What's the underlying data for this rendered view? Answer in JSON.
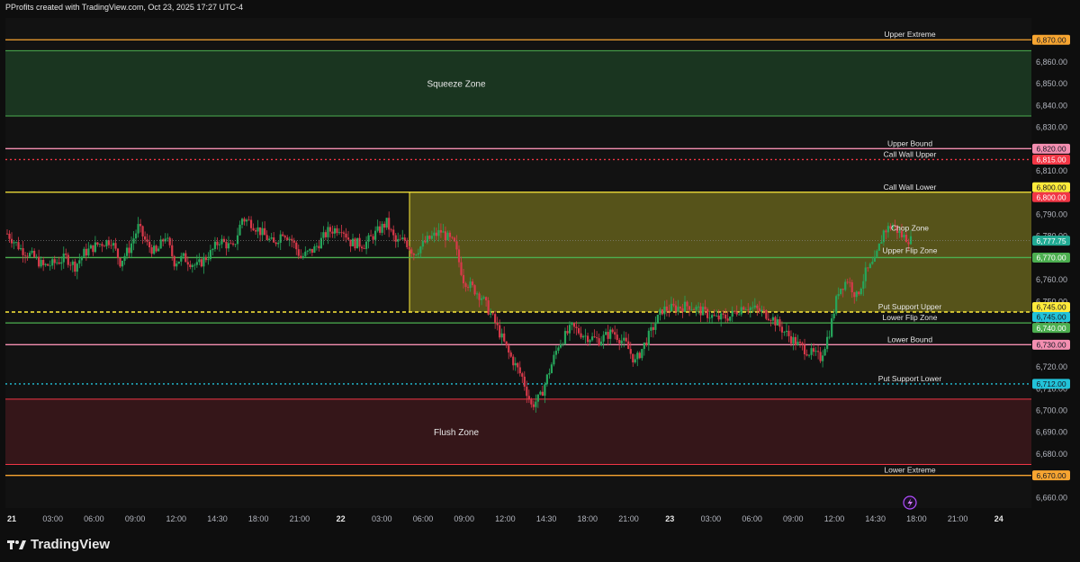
{
  "header": {
    "attribution": "PProfits created with TradingView.com, Oct 23, 2025 17:27 UTC-4"
  },
  "footer": {
    "brand": "TradingView"
  },
  "chart_data": {
    "type": "candlestick",
    "symbol_interval": "intraday",
    "ylim": [
      6655,
      6880
    ],
    "y_ticks": [
      6660,
      6670,
      6680,
      6690,
      6700,
      6710,
      6720,
      6730,
      6740,
      6750,
      6760,
      6770,
      6780,
      6790,
      6800,
      6810,
      6820,
      6830,
      6840,
      6850,
      6860,
      6870
    ],
    "x_ticks": [
      {
        "label": "21",
        "bold": true
      },
      {
        "label": "03:00"
      },
      {
        "label": "06:00"
      },
      {
        "label": "09:00"
      },
      {
        "label": "12:00"
      },
      {
        "label": "14:30"
      },
      {
        "label": "18:00"
      },
      {
        "label": "21:00"
      },
      {
        "label": "22",
        "bold": true
      },
      {
        "label": "03:00"
      },
      {
        "label": "06:00"
      },
      {
        "label": "09:00"
      },
      {
        "label": "12:00"
      },
      {
        "label": "14:30"
      },
      {
        "label": "18:00"
      },
      {
        "label": "21:00"
      },
      {
        "label": "23",
        "bold": true
      },
      {
        "label": "03:00"
      },
      {
        "label": "06:00"
      },
      {
        "label": "09:00"
      },
      {
        "label": "12:00"
      },
      {
        "label": "14:30"
      },
      {
        "label": "18:00"
      },
      {
        "label": "21:00"
      },
      {
        "label": "24",
        "bold": true
      }
    ],
    "price_path": [
      [
        0,
        6781
      ],
      [
        6,
        6774
      ],
      [
        12,
        6770
      ],
      [
        16,
        6766
      ],
      [
        20,
        6767
      ],
      [
        26,
        6770
      ],
      [
        30,
        6766
      ],
      [
        34,
        6772
      ],
      [
        40,
        6776
      ],
      [
        46,
        6778
      ],
      [
        50,
        6768
      ],
      [
        54,
        6774
      ],
      [
        58,
        6784
      ],
      [
        62,
        6776
      ],
      [
        66,
        6772
      ],
      [
        70,
        6780
      ],
      [
        74,
        6768
      ],
      [
        78,
        6770
      ],
      [
        84,
        6766
      ],
      [
        90,
        6772
      ],
      [
        94,
        6778
      ],
      [
        100,
        6774
      ],
      [
        104,
        6788
      ],
      [
        108,
        6786
      ],
      [
        112,
        6782
      ],
      [
        118,
        6776
      ],
      [
        122,
        6782
      ],
      [
        126,
        6778
      ],
      [
        130,
        6770
      ],
      [
        136,
        6774
      ],
      [
        142,
        6782
      ],
      [
        148,
        6784
      ],
      [
        152,
        6777
      ],
      [
        158,
        6776
      ],
      [
        164,
        6782
      ],
      [
        168,
        6786
      ],
      [
        172,
        6777
      ],
      [
        176,
        6778
      ],
      [
        180,
        6772
      ],
      [
        186,
        6778
      ],
      [
        192,
        6782
      ],
      [
        198,
        6776
      ],
      [
        202,
        6760
      ],
      [
        210,
        6752
      ],
      [
        216,
        6740
      ],
      [
        222,
        6726
      ],
      [
        228,
        6715
      ],
      [
        232,
        6702
      ],
      [
        236,
        6706
      ],
      [
        240,
        6718
      ],
      [
        244,
        6730
      ],
      [
        250,
        6738
      ],
      [
        256,
        6734
      ],
      [
        262,
        6732
      ],
      [
        268,
        6736
      ],
      [
        274,
        6730
      ],
      [
        278,
        6722
      ],
      [
        284,
        6734
      ],
      [
        290,
        6746
      ],
      [
        296,
        6747
      ],
      [
        302,
        6748
      ],
      [
        308,
        6745
      ],
      [
        314,
        6742
      ],
      [
        320,
        6743
      ],
      [
        326,
        6748
      ],
      [
        332,
        6746
      ],
      [
        338,
        6743
      ],
      [
        344,
        6736
      ],
      [
        350,
        6730
      ],
      [
        356,
        6726
      ],
      [
        360,
        6724
      ],
      [
        364,
        6736
      ],
      [
        368,
        6755
      ],
      [
        372,
        6760
      ],
      [
        376,
        6752
      ],
      [
        380,
        6763
      ],
      [
        384,
        6768
      ],
      [
        388,
        6782
      ],
      [
        392,
        6785
      ],
      [
        396,
        6780
      ],
      [
        400,
        6778
      ]
    ],
    "current_price": "6,777.75",
    "levels": [
      {
        "label": "Upper Extreme",
        "price": 6870,
        "price_label": "6,870.00",
        "color": "#f7a531",
        "style": "solid"
      },
      {
        "label": "Upper Bound",
        "price": 6820,
        "price_label": "6,820.00",
        "color": "#f48fb1",
        "style": "solid"
      },
      {
        "label": "Call Wall Upper",
        "price": 6815,
        "price_label": "6,815.00",
        "color": "#f23645",
        "style": "dotted"
      },
      {
        "label": "Call Wall Lower",
        "price": 6800,
        "price_label": "6,800.00",
        "color": "#ffeb3b",
        "style": "solid"
      },
      {
        "label": "",
        "price": 6800,
        "price_label": "6,800.00",
        "color": "#f23645",
        "style": "none"
      },
      {
        "label": "Chop Zone",
        "price": 6777.75,
        "price_label": "6,777.75",
        "color": "#22ab94",
        "style": "none"
      },
      {
        "label": "Upper Flip Zone",
        "price": 6770,
        "price_label": "6,770.00",
        "color": "#4caf50",
        "style": "solid"
      },
      {
        "label": "Put Support Upper",
        "price": 6745,
        "price_label": "6,745.00",
        "color": "#ffeb3b",
        "style": "dashed"
      },
      {
        "label": "",
        "price": 6745,
        "price_label": "6,745.00",
        "color": "#22c3d9",
        "style": "none"
      },
      {
        "label": "Lower Flip Zone",
        "price": 6740,
        "price_label": "6,740.00",
        "color": "#4caf50",
        "style": "solid"
      },
      {
        "label": "Lower Bound",
        "price": 6730,
        "price_label": "6,730.00",
        "color": "#f48fb1",
        "style": "solid"
      },
      {
        "label": "Put Support Lower",
        "price": 6712,
        "price_label": "6,712.00",
        "color": "#22c3d9",
        "style": "dotted"
      },
      {
        "label": "Lower Extreme",
        "price": 6670,
        "price_label": "6,670.00",
        "color": "#f7a531",
        "style": "solid"
      }
    ],
    "zones": [
      {
        "label": "Squeeze Zone",
        "from": 6835,
        "to": 6865,
        "fill": "#1c3a22",
        "border": "#4caf50"
      },
      {
        "label": "Chop Zone",
        "from": 6745,
        "to": 6800,
        "fill": "#6e6a1e",
        "border": "#ffeb3b"
      },
      {
        "label": "Flush Zone",
        "from": 6675,
        "to": 6705,
        "fill": "#3a171b",
        "border": "#f23645"
      }
    ]
  }
}
